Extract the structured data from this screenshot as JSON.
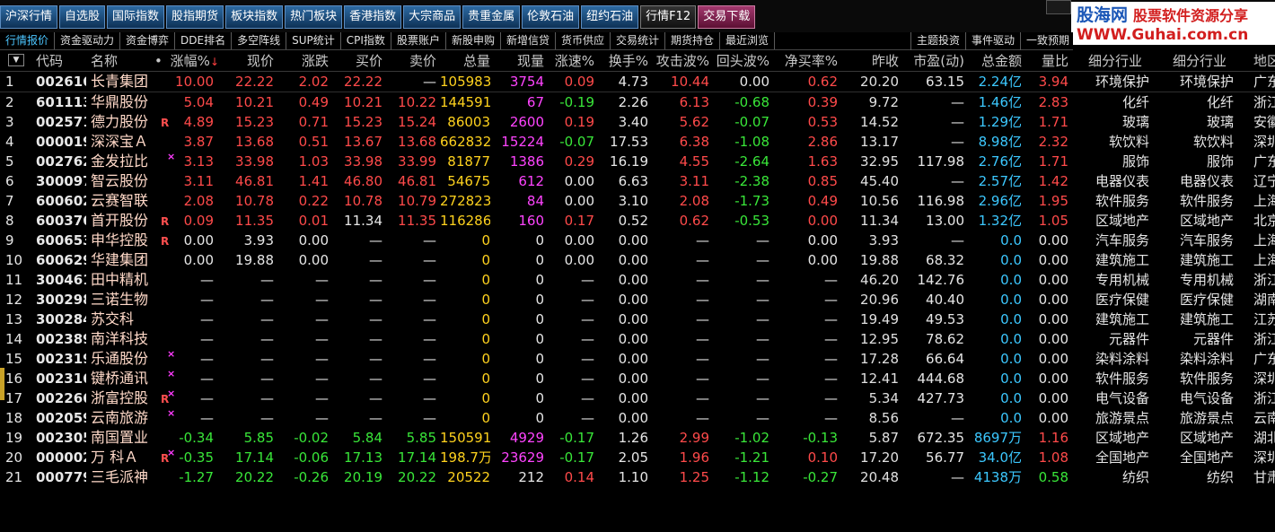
{
  "toolbar": {
    "buttons": [
      "沪深行情",
      "自选股",
      "国际指数",
      "股指期货",
      "板块指数",
      "热门板块",
      "香港指数",
      "大宗商品",
      "贵重金属",
      "伦敦石油",
      "纽约石油",
      "行情F12",
      "交易下载"
    ]
  },
  "logo": {
    "line1": "股海网",
    "tag": "股票软件资源分享",
    "line2": "WWW.Guhai.com.cn"
  },
  "tabs": [
    "行情报价",
    "资金驱动力",
    "资金博弈",
    "DDE排名",
    "多空阵线",
    "SUP统计",
    "CPI指数",
    "股票账户",
    "新股申购",
    "新增信贷",
    "货币供应",
    "交易统计",
    "期货持仓",
    "最近浏览"
  ],
  "tabs_right": [
    "主题投资",
    "事件驱动",
    "一致预期"
  ],
  "table": {
    "headers": [
      "代码",
      "名称",
      "•",
      "涨幅%",
      "现价",
      "涨跌",
      "买价",
      "卖价",
      "总量",
      "现量",
      "涨速%",
      "换手%",
      "攻击波%",
      "回头波%",
      "净买率%",
      "昨收",
      "市盈(动)",
      "总金额",
      "量比",
      "细分行业",
      "细分行业",
      "地区"
    ],
    "sort_indicator": "↓",
    "dropdown": "▼",
    "rows": [
      {
        "n": "1",
        "code": "002616",
        "name": "长青集团",
        "mark": "",
        "pct": "10.00",
        "price": "22.22",
        "chg": "2.02",
        "bid": "22.22",
        "ask": "—",
        "vol": "105983",
        "cur": "3754",
        "spd": "0.09",
        "turn": "4.73",
        "atk": "10.44",
        "back": "0.00",
        "net": "0.62",
        "prev": "20.20",
        "pe": "63.15",
        "amt": "2.24亿",
        "vr": "3.94",
        "ind1": "环境保护",
        "ind2": "环境保护",
        "reg": "广东",
        "dir": "up",
        "spdc": "up",
        "atkc": "up",
        "backc": "w",
        "netc": "up",
        "amtc": "c"
      },
      {
        "n": "2",
        "code": "601113",
        "name": "华鼎股份",
        "mark": "",
        "pct": "5.04",
        "price": "10.21",
        "chg": "0.49",
        "bid": "10.21",
        "ask": "10.22",
        "vol": "144591",
        "cur": "67",
        "spd": "-0.19",
        "turn": "2.26",
        "atk": "6.13",
        "back": "-0.68",
        "net": "0.39",
        "prev": "9.72",
        "pe": "—",
        "amt": "1.46亿",
        "vr": "2.83",
        "ind1": "化纤",
        "ind2": "化纤",
        "reg": "浙江",
        "dir": "up",
        "spdc": "dn",
        "atkc": "up",
        "backc": "dn",
        "netc": "up",
        "amtc": "c"
      },
      {
        "n": "3",
        "code": "002571",
        "name": "德力股份",
        "mark": "R",
        "pct": "4.89",
        "price": "15.23",
        "chg": "0.71",
        "bid": "15.23",
        "ask": "15.24",
        "vol": "86003",
        "cur": "2600",
        "spd": "0.19",
        "turn": "3.40",
        "atk": "5.62",
        "back": "-0.07",
        "net": "0.53",
        "prev": "14.52",
        "pe": "—",
        "amt": "1.29亿",
        "vr": "1.71",
        "ind1": "玻璃",
        "ind2": "玻璃",
        "reg": "安徽",
        "dir": "up",
        "spdc": "up",
        "atkc": "up",
        "backc": "dn",
        "netc": "up",
        "amtc": "c"
      },
      {
        "n": "4",
        "code": "000019",
        "name": "深深宝Ａ",
        "mark": "",
        "pct": "3.87",
        "price": "13.68",
        "chg": "0.51",
        "bid": "13.67",
        "ask": "13.68",
        "vol": "662832",
        "cur": "15224",
        "spd": "-0.07",
        "turn": "17.53",
        "atk": "6.38",
        "back": "-1.08",
        "net": "2.86",
        "prev": "13.17",
        "pe": "—",
        "amt": "8.98亿",
        "vr": "2.32",
        "ind1": "软饮料",
        "ind2": "软饮料",
        "reg": "深圳",
        "dir": "up",
        "spdc": "dn",
        "atkc": "up",
        "backc": "dn",
        "netc": "up",
        "amtc": "c"
      },
      {
        "n": "5",
        "code": "002762",
        "name": "金发拉比",
        "mark": "X",
        "pct": "3.13",
        "price": "33.98",
        "chg": "1.03",
        "bid": "33.98",
        "ask": "33.99",
        "vol": "81877",
        "cur": "1386",
        "spd": "0.29",
        "turn": "16.19",
        "atk": "4.55",
        "back": "-2.64",
        "net": "1.63",
        "prev": "32.95",
        "pe": "117.98",
        "amt": "2.76亿",
        "vr": "1.71",
        "ind1": "服饰",
        "ind2": "服饰",
        "reg": "广东",
        "dir": "up",
        "spdc": "up",
        "atkc": "up",
        "backc": "dn",
        "netc": "up",
        "amtc": "c"
      },
      {
        "n": "6",
        "code": "300097",
        "name": "智云股份",
        "mark": "",
        "pct": "3.11",
        "price": "46.81",
        "chg": "1.41",
        "bid": "46.80",
        "ask": "46.81",
        "vol": "54675",
        "cur": "612",
        "spd": "0.00",
        "turn": "6.63",
        "atk": "3.11",
        "back": "-2.38",
        "net": "0.85",
        "prev": "45.40",
        "pe": "—",
        "amt": "2.57亿",
        "vr": "1.42",
        "ind1": "电器仪表",
        "ind2": "电器仪表",
        "reg": "辽宁",
        "dir": "up",
        "spdc": "w",
        "atkc": "up",
        "backc": "dn",
        "netc": "up",
        "amtc": "c"
      },
      {
        "n": "7",
        "code": "600602",
        "name": "云赛智联",
        "mark": "",
        "pct": "2.08",
        "price": "10.78",
        "chg": "0.22",
        "bid": "10.78",
        "ask": "10.79",
        "vol": "272823",
        "cur": "84",
        "spd": "0.00",
        "turn": "3.10",
        "atk": "2.08",
        "back": "-1.73",
        "net": "0.49",
        "prev": "10.56",
        "pe": "116.98",
        "amt": "2.96亿",
        "vr": "1.95",
        "ind1": "软件服务",
        "ind2": "软件服务",
        "reg": "上海",
        "dir": "up",
        "spdc": "w",
        "atkc": "up",
        "backc": "dn",
        "netc": "up",
        "amtc": "c"
      },
      {
        "n": "8",
        "code": "600376",
        "name": "首开股份",
        "mark": "R",
        "pct": "0.09",
        "price": "11.35",
        "chg": "0.01",
        "bid": "11.34",
        "ask": "11.35",
        "vol": "116286",
        "cur": "160",
        "spd": "0.17",
        "turn": "0.52",
        "atk": "0.62",
        "back": "-0.53",
        "net": "0.00",
        "prev": "11.34",
        "pe": "13.00",
        "amt": "1.32亿",
        "vr": "1.05",
        "ind1": "区域地产",
        "ind2": "区域地产",
        "reg": "北京",
        "dir": "up",
        "spdc": "up",
        "atkc": "up",
        "backc": "dn",
        "netc": "up",
        "amtc": "c",
        "bidc": "w"
      },
      {
        "n": "9",
        "code": "600653",
        "name": "申华控股",
        "mark": "R",
        "pct": "0.00",
        "price": "3.93",
        "chg": "0.00",
        "bid": "—",
        "ask": "—",
        "vol": "0",
        "cur": "0",
        "spd": "0.00",
        "turn": "0.00",
        "atk": "—",
        "back": "—",
        "net": "0.00",
        "prev": "3.93",
        "pe": "—",
        "amt": "0.0",
        "vr": "0.00",
        "ind1": "汽车服务",
        "ind2": "汽车服务",
        "reg": "上海",
        "dir": "w",
        "spdc": "w",
        "atkc": "w",
        "backc": "w",
        "netc": "w",
        "amtc": "c"
      },
      {
        "n": "10",
        "code": "600629",
        "name": "华建集团",
        "mark": "",
        "pct": "0.00",
        "price": "19.88",
        "chg": "0.00",
        "bid": "—",
        "ask": "—",
        "vol": "0",
        "cur": "0",
        "spd": "0.00",
        "turn": "0.00",
        "atk": "—",
        "back": "—",
        "net": "0.00",
        "prev": "19.88",
        "pe": "68.32",
        "amt": "0.0",
        "vr": "0.00",
        "ind1": "建筑施工",
        "ind2": "建筑施工",
        "reg": "上海",
        "dir": "w",
        "spdc": "w",
        "atkc": "w",
        "backc": "w",
        "netc": "w",
        "amtc": "c"
      },
      {
        "n": "11",
        "code": "300461",
        "name": "田中精机",
        "mark": "",
        "pct": "—",
        "price": "—",
        "chg": "—",
        "bid": "—",
        "ask": "—",
        "vol": "0",
        "cur": "0",
        "spd": "—",
        "turn": "0.00",
        "atk": "—",
        "back": "—",
        "net": "—",
        "prev": "46.20",
        "pe": "142.76",
        "amt": "0.0",
        "vr": "0.00",
        "ind1": "专用机械",
        "ind2": "专用机械",
        "reg": "浙江",
        "dir": "w",
        "spdc": "w",
        "atkc": "w",
        "backc": "w",
        "netc": "w",
        "amtc": "c"
      },
      {
        "n": "12",
        "code": "300298",
        "name": "三诺生物",
        "mark": "",
        "pct": "—",
        "price": "—",
        "chg": "—",
        "bid": "—",
        "ask": "—",
        "vol": "0",
        "cur": "0",
        "spd": "—",
        "turn": "0.00",
        "atk": "—",
        "back": "—",
        "net": "—",
        "prev": "20.96",
        "pe": "40.40",
        "amt": "0.0",
        "vr": "0.00",
        "ind1": "医疗保健",
        "ind2": "医疗保健",
        "reg": "湖南",
        "dir": "w",
        "spdc": "w",
        "atkc": "w",
        "backc": "w",
        "netc": "w",
        "amtc": "c"
      },
      {
        "n": "13",
        "code": "300284",
        "name": "苏交科",
        "mark": "",
        "pct": "—",
        "price": "—",
        "chg": "—",
        "bid": "—",
        "ask": "—",
        "vol": "0",
        "cur": "0",
        "spd": "—",
        "turn": "0.00",
        "atk": "—",
        "back": "—",
        "net": "—",
        "prev": "19.49",
        "pe": "49.53",
        "amt": "0.0",
        "vr": "0.00",
        "ind1": "建筑施工",
        "ind2": "建筑施工",
        "reg": "江苏",
        "dir": "w",
        "spdc": "w",
        "atkc": "w",
        "backc": "w",
        "netc": "w",
        "amtc": "c"
      },
      {
        "n": "14",
        "code": "002389",
        "name": "南洋科技",
        "mark": "",
        "pct": "—",
        "price": "—",
        "chg": "—",
        "bid": "—",
        "ask": "—",
        "vol": "0",
        "cur": "0",
        "spd": "—",
        "turn": "0.00",
        "atk": "—",
        "back": "—",
        "net": "—",
        "prev": "12.95",
        "pe": "78.62",
        "amt": "0.0",
        "vr": "0.00",
        "ind1": "元器件",
        "ind2": "元器件",
        "reg": "浙江",
        "dir": "w",
        "spdc": "w",
        "atkc": "w",
        "backc": "w",
        "netc": "w",
        "amtc": "c"
      },
      {
        "n": "15",
        "code": "002319",
        "name": "乐通股份",
        "mark": "X",
        "pct": "—",
        "price": "—",
        "chg": "—",
        "bid": "—",
        "ask": "—",
        "vol": "0",
        "cur": "0",
        "spd": "—",
        "turn": "0.00",
        "atk": "—",
        "back": "—",
        "net": "—",
        "prev": "17.28",
        "pe": "66.64",
        "amt": "0.0",
        "vr": "0.00",
        "ind1": "染料涂料",
        "ind2": "染料涂料",
        "reg": "广东",
        "dir": "w",
        "spdc": "w",
        "atkc": "w",
        "backc": "w",
        "netc": "w",
        "amtc": "c"
      },
      {
        "n": "16",
        "code": "002316",
        "name": "键桥通讯",
        "mark": "X",
        "pct": "—",
        "price": "—",
        "chg": "—",
        "bid": "—",
        "ask": "—",
        "vol": "0",
        "cur": "0",
        "spd": "—",
        "turn": "0.00",
        "atk": "—",
        "back": "—",
        "net": "—",
        "prev": "12.41",
        "pe": "444.68",
        "amt": "0.0",
        "vr": "0.00",
        "ind1": "软件服务",
        "ind2": "软件服务",
        "reg": "深圳",
        "dir": "w",
        "spdc": "w",
        "atkc": "w",
        "backc": "w",
        "netc": "w",
        "amtc": "c"
      },
      {
        "n": "17",
        "code": "002266",
        "name": "浙富控股",
        "mark": "RX",
        "pct": "—",
        "price": "—",
        "chg": "—",
        "bid": "—",
        "ask": "—",
        "vol": "0",
        "cur": "0",
        "spd": "—",
        "turn": "0.00",
        "atk": "—",
        "back": "—",
        "net": "—",
        "prev": "5.34",
        "pe": "427.73",
        "amt": "0.0",
        "vr": "0.00",
        "ind1": "电气设备",
        "ind2": "电气设备",
        "reg": "浙江",
        "dir": "w",
        "spdc": "w",
        "atkc": "w",
        "backc": "w",
        "netc": "w",
        "amtc": "c"
      },
      {
        "n": "18",
        "code": "002059",
        "name": "云南旅游",
        "mark": "X",
        "pct": "—",
        "price": "—",
        "chg": "—",
        "bid": "—",
        "ask": "—",
        "vol": "0",
        "cur": "0",
        "spd": "—",
        "turn": "0.00",
        "atk": "—",
        "back": "—",
        "net": "—",
        "prev": "8.56",
        "pe": "—",
        "amt": "0.0",
        "vr": "0.00",
        "ind1": "旅游景点",
        "ind2": "旅游景点",
        "reg": "云南",
        "dir": "w",
        "spdc": "w",
        "atkc": "w",
        "backc": "w",
        "netc": "w",
        "amtc": "c"
      },
      {
        "n": "19",
        "code": "002305",
        "name": "南国置业",
        "mark": "",
        "pct": "-0.34",
        "price": "5.85",
        "chg": "-0.02",
        "bid": "5.84",
        "ask": "5.85",
        "vol": "150591",
        "cur": "4929",
        "spd": "-0.17",
        "turn": "1.26",
        "atk": "2.99",
        "back": "-1.02",
        "net": "-0.13",
        "prev": "5.87",
        "pe": "672.35",
        "amt": "8697万",
        "vr": "1.16",
        "ind1": "区域地产",
        "ind2": "区域地产",
        "reg": "湖北",
        "dir": "dn",
        "spdc": "dn",
        "atkc": "up",
        "backc": "dn",
        "netc": "dn",
        "amtc": "c"
      },
      {
        "n": "20",
        "code": "000002",
        "name": "万 科Ａ",
        "mark": "RX",
        "pct": "-0.35",
        "price": "17.14",
        "chg": "-0.06",
        "bid": "17.13",
        "ask": "17.14",
        "vol": "198.7万",
        "cur": "23629",
        "spd": "-0.17",
        "turn": "2.05",
        "atk": "1.96",
        "back": "-1.21",
        "net": "0.10",
        "prev": "17.20",
        "pe": "56.77",
        "amt": "34.0亿",
        "vr": "1.08",
        "ind1": "全国地产",
        "ind2": "全国地产",
        "reg": "深圳",
        "dir": "dn",
        "spdc": "dn",
        "atkc": "up",
        "backc": "dn",
        "netc": "up",
        "amtc": "c"
      },
      {
        "n": "21",
        "code": "000779",
        "name": "三毛派神",
        "mark": "",
        "pct": "-1.27",
        "price": "20.22",
        "chg": "-0.26",
        "bid": "20.19",
        "ask": "20.22",
        "vol": "20522",
        "cur": "212",
        "spd": "0.14",
        "turn": "1.10",
        "atk": "1.25",
        "back": "-1.12",
        "net": "-0.27",
        "prev": "20.48",
        "pe": "—",
        "amt": "4138万",
        "vr": "0.58",
        "ind1": "纺织",
        "ind2": "纺织",
        "reg": "甘肃",
        "dir": "dn",
        "spdc": "up",
        "atkc": "up",
        "backc": "dn",
        "netc": "dn",
        "amtc": "c",
        "curc": "w"
      }
    ]
  },
  "colors": {
    "up": "#ff4a4a",
    "dn": "#39e639",
    "w": "#e6e6e6",
    "code": "#e8e8e8",
    "vol": "#ffd21e",
    "cur": "#ff44ff",
    "amt": "#3cc8ff",
    "name": "#ffd9c8",
    "prev": "#e0e0e0"
  }
}
